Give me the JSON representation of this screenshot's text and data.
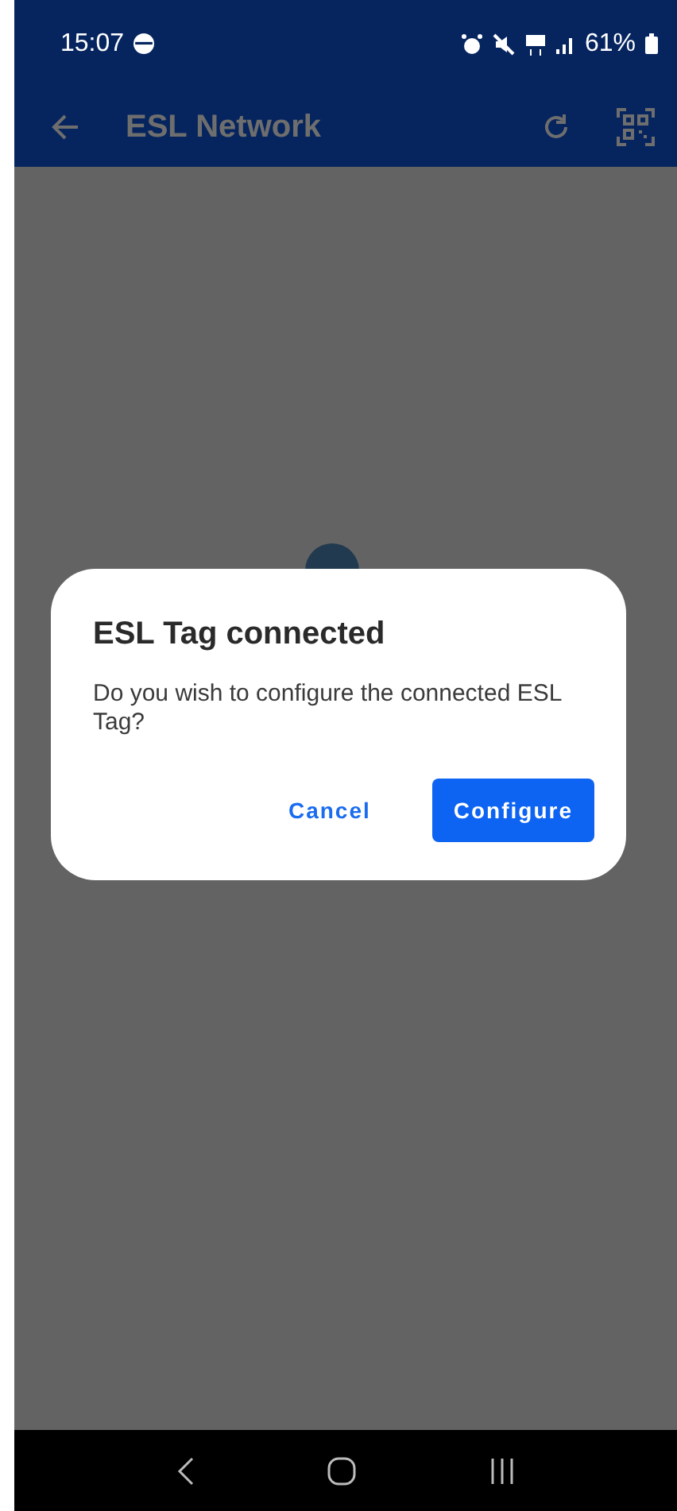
{
  "status_bar": {
    "time": "15:07",
    "battery": "61%"
  },
  "app_bar": {
    "title": "ESL Network"
  },
  "loading": true,
  "dialog": {
    "title": "ESL Tag connected",
    "message": "Do you wish to configure the connected ESL Tag?",
    "buttons": [
      {
        "label": "Cancel",
        "kind": "text"
      },
      {
        "label": "Configure",
        "kind": "filled"
      }
    ]
  }
}
